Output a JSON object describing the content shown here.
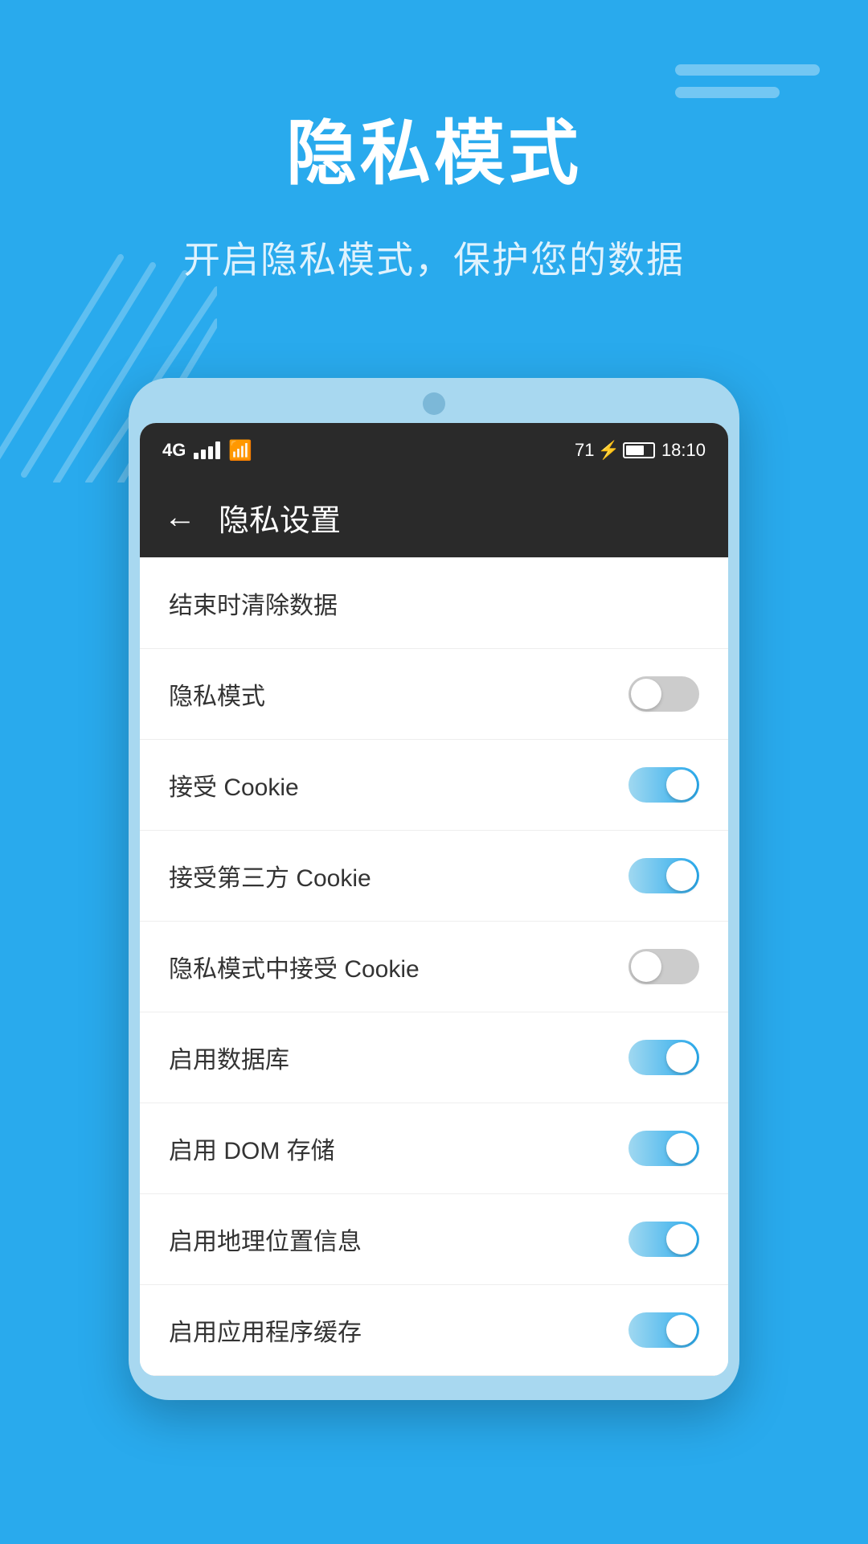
{
  "background": {
    "color": "#29aaed"
  },
  "header": {
    "title": "隐私模式",
    "subtitle": "开启隐私模式，保护您的数据"
  },
  "status_bar": {
    "network": "4G",
    "battery": "71",
    "charging": true,
    "time": "18:10"
  },
  "nav": {
    "back_icon": "←",
    "title": "隐私设置"
  },
  "settings": {
    "items": [
      {
        "id": "clear-on-exit",
        "label": "结束时清除数据",
        "has_toggle": false,
        "toggle_on": false
      },
      {
        "id": "privacy-mode",
        "label": "隐私模式",
        "has_toggle": true,
        "toggle_on": false
      },
      {
        "id": "accept-cookie",
        "label": "接受 Cookie",
        "has_toggle": true,
        "toggle_on": true
      },
      {
        "id": "accept-third-party-cookie",
        "label": "接受第三方 Cookie",
        "has_toggle": true,
        "toggle_on": true
      },
      {
        "id": "privacy-cookie",
        "label": "隐私模式中接受 Cookie",
        "has_toggle": true,
        "toggle_on": false
      },
      {
        "id": "enable-database",
        "label": "启用数据库",
        "has_toggle": true,
        "toggle_on": true
      },
      {
        "id": "enable-dom-storage",
        "label": "启用 DOM 存储",
        "has_toggle": true,
        "toggle_on": true
      },
      {
        "id": "enable-geolocation",
        "label": "启用地理位置信息",
        "has_toggle": true,
        "toggle_on": true
      },
      {
        "id": "enable-app-cache",
        "label": "启用应用程序缓存",
        "has_toggle": true,
        "toggle_on": true
      }
    ]
  },
  "top_right_bars": [
    {
      "width": 180
    },
    {
      "width": 130
    }
  ]
}
